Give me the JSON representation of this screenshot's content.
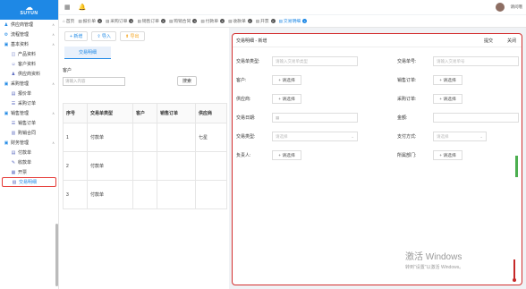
{
  "brand": {
    "logo_text": "SUYUN"
  },
  "sidebar": {
    "items": [
      {
        "label": "供应商管理",
        "level": 0,
        "icon": "supplier-icon"
      },
      {
        "label": "流程管理",
        "level": 0,
        "icon": "process-icon"
      },
      {
        "label": "基本资料",
        "level": 0,
        "icon": "folder-icon"
      },
      {
        "label": "产品资料",
        "level": 1,
        "icon": "product-icon"
      },
      {
        "label": "客户资料",
        "level": 1,
        "icon": "customer-icon"
      },
      {
        "label": "供应商资料",
        "level": 1,
        "icon": "supplier-icon"
      },
      {
        "label": "采购管理",
        "level": 0,
        "icon": "folder-icon"
      },
      {
        "label": "报价单",
        "level": 1,
        "icon": "quote-icon"
      },
      {
        "label": "采购订单",
        "level": 1,
        "icon": "order-icon"
      },
      {
        "label": "销售管理",
        "level": 0,
        "icon": "folder-icon"
      },
      {
        "label": "销售订单",
        "level": 1,
        "icon": "order-icon"
      },
      {
        "label": "购销合同",
        "level": 1,
        "icon": "contract-icon"
      },
      {
        "label": "财务管理",
        "level": 0,
        "icon": "folder-icon"
      },
      {
        "label": "付款单",
        "level": 1,
        "icon": "payment-icon"
      },
      {
        "label": "收款单",
        "level": 1,
        "icon": "receipt-icon"
      },
      {
        "label": "开票",
        "level": 1,
        "icon": "invoice-icon"
      },
      {
        "label": "交易明细",
        "level": 1,
        "icon": "detail-icon"
      }
    ]
  },
  "header": {
    "username": "请问哦"
  },
  "tabs": [
    {
      "label": "首页"
    },
    {
      "label": "报价单"
    },
    {
      "label": "采购订单"
    },
    {
      "label": "销售订单"
    },
    {
      "label": "购销合同"
    },
    {
      "label": "付款单"
    },
    {
      "label": "收款单"
    },
    {
      "label": "开票"
    },
    {
      "label": "交易明细"
    }
  ],
  "toolbar": {
    "add": "新增",
    "import": "导入",
    "export": "导出"
  },
  "list": {
    "subtab": "交易明细",
    "customer_label": "客户",
    "search_placeholder": "请输入内容",
    "search_button": "搜索",
    "columns": [
      "序号",
      "交易单类型",
      "客户",
      "销售订单",
      "供应商"
    ],
    "rows": [
      {
        "no": "1",
        "type": "付款单",
        "customer": "",
        "sales": "",
        "supplier": "七星"
      },
      {
        "no": "2",
        "type": "付款单",
        "customer": "",
        "sales": "",
        "supplier": ""
      },
      {
        "no": "3",
        "type": "付款单",
        "customer": "",
        "sales": "",
        "supplier": ""
      }
    ]
  },
  "panel": {
    "title": "交易明细 - 新增",
    "submit": "提交",
    "close": "关闭",
    "fields": {
      "type_label": "交易单类型:",
      "type_placeholder": "请输入交易单类型",
      "no_label": "交易单号:",
      "no_placeholder": "请输入交易单号",
      "customer_label": "客户:",
      "sales_label": "销售订单:",
      "supplier_label": "供应商:",
      "purchase_label": "采购订单:",
      "date_label": "交易日期:",
      "amount_label": "金额:",
      "kind_label": "交易类型:",
      "kind_placeholder": "请选择",
      "paymethod_label": "支付方式:",
      "paymethod_placeholder": "请选择",
      "owner_label": "负责人:",
      "dept_label": "所属部门:",
      "pick_label": "+ 请选择"
    }
  },
  "watermark": {
    "line1": "激活 Windows",
    "line2": "转到\"设置\"以激活 Windows。"
  }
}
